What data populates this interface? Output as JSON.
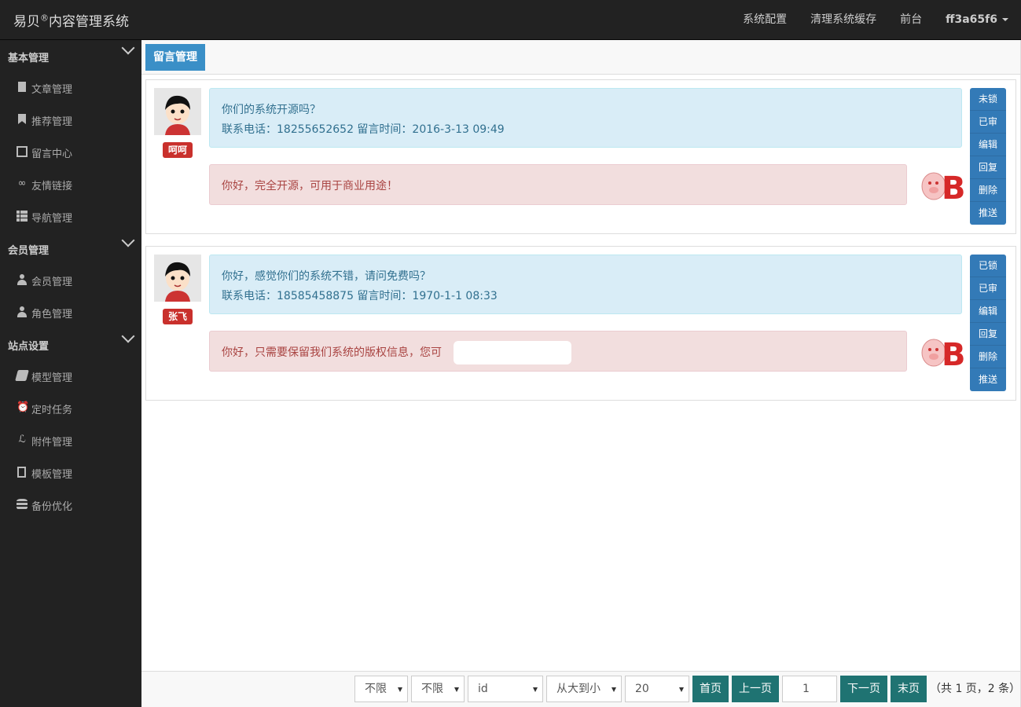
{
  "app": {
    "brand_main": "易贝",
    "brand_mark": "®",
    "brand_rest": "内容管理系统"
  },
  "topnav": {
    "config": "系统配置",
    "clear_cache": "清理系统缓存",
    "frontend": "前台",
    "user": "ff3a65f6"
  },
  "sidebar": {
    "sections": [
      {
        "label": "基本管理",
        "items": [
          {
            "label": "文章管理",
            "icon": "file-icon"
          },
          {
            "label": "推荐管理",
            "icon": "bookmark-icon"
          },
          {
            "label": "留言中心",
            "icon": "edit-icon"
          },
          {
            "label": "友情链接",
            "icon": "link-icon"
          },
          {
            "label": "导航管理",
            "icon": "th-list-icon"
          }
        ]
      },
      {
        "label": "会员管理",
        "items": [
          {
            "label": "会员管理",
            "icon": "user-icon"
          },
          {
            "label": "角色管理",
            "icon": "user-key-icon"
          }
        ]
      },
      {
        "label": "站点设置",
        "items": [
          {
            "label": "模型管理",
            "icon": "cube-icon"
          },
          {
            "label": "定时任务",
            "icon": "alarm-icon"
          },
          {
            "label": "附件管理",
            "icon": "paperclip-icon"
          },
          {
            "label": "模板管理",
            "icon": "template-icon"
          },
          {
            "label": "备份优化",
            "icon": "database-icon"
          }
        ]
      }
    ]
  },
  "page": {
    "tab": "留言管理"
  },
  "messages": [
    {
      "name": "呵呵",
      "question": "你们的系统开源吗？",
      "meta": "联系电话：18255652652 留言时间：2016-3-13 09:49",
      "reply": "你好，完全开源，可用于商业用途！",
      "actions": [
        "未锁",
        "已审",
        "编辑",
        "回复",
        "删除",
        "推送"
      ]
    },
    {
      "name": "张飞",
      "question": "你好，感觉你们的系统不错，请问免费吗？",
      "meta": "联系电话：18585458875 留言时间：1970-1-1 08:33",
      "reply": "你好，只需要保留我们系统的版权信息，您可",
      "actions": [
        "已锁",
        "已审",
        "编辑",
        "回复",
        "删除",
        "推送"
      ]
    }
  ],
  "pager": {
    "filter1": "不限",
    "filter2": "不限",
    "field": "id",
    "order": "从大到小",
    "per_page": "20",
    "first": "首页",
    "prev": "上一页",
    "current": "1",
    "next": "下一页",
    "last": "末页",
    "info": "（共 1 页，2 条）"
  },
  "colors": {
    "topbar": "#222222",
    "tab": "#3a8fc7",
    "question_bg": "#d9edf7",
    "reply_bg": "#f2dede",
    "action_btn": "#337ab7",
    "pager_btn": "#1f7372",
    "badge": "#c9302c"
  }
}
